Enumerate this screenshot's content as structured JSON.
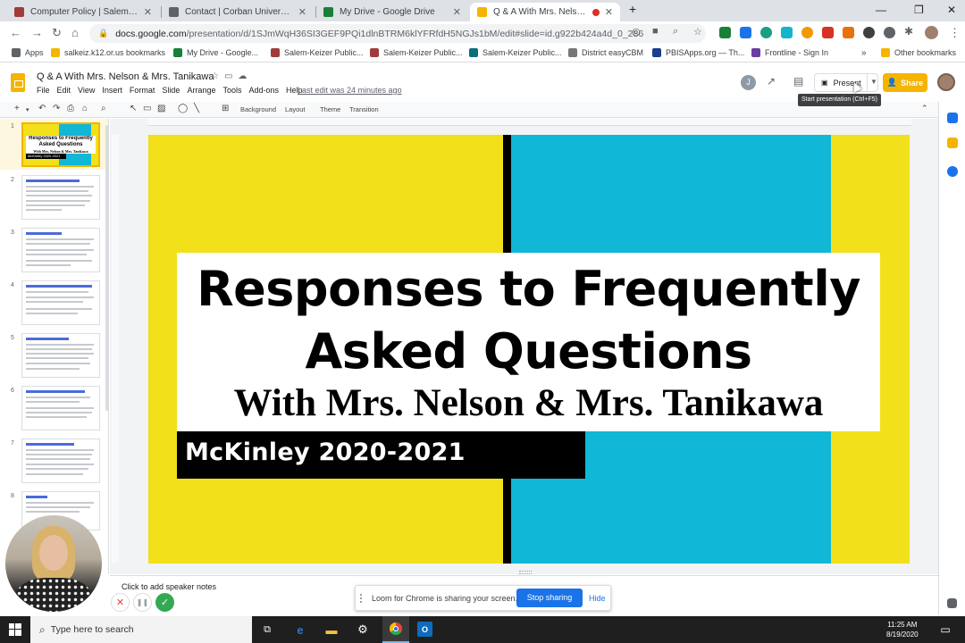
{
  "tabs": [
    {
      "title": "Computer Policy | Salem-Keizer P",
      "favicon": "#a33a3a"
    },
    {
      "title": "Contact | Corban University",
      "favicon": "#5f6368"
    },
    {
      "title": "My Drive - Google Drive",
      "favicon": "#188038"
    },
    {
      "title": "Q & A With Mrs. Nelson & M",
      "favicon": "#f4b400"
    }
  ],
  "address": {
    "host": "docs.google.com",
    "path": "/presentation/d/1SJmWqH36SI3GEF9PQi1dlnBTRM6klYFRfdH5NGJs1bM/edit#slide=id.g922b424a4d_0_286"
  },
  "bookmarks": [
    {
      "label": "Apps",
      "color": "#5f6368"
    },
    {
      "label": "salkeiz.k12.or.us bookmarks",
      "color": "#f4b400"
    },
    {
      "label": "My Drive - Google...",
      "color": "#188038"
    },
    {
      "label": "Salem-Keizer Public...",
      "color": "#a33a3a"
    },
    {
      "label": "Salem-Keizer Public...",
      "color": "#a33a3a"
    },
    {
      "label": "Salem-Keizer Public...",
      "color": "#0b6e7a"
    },
    {
      "label": "District easyCBM",
      "color": "#777777"
    },
    {
      "label": "PBISApps.org — Th...",
      "color": "#1a3d8f"
    },
    {
      "label": "Frontline - Sign In",
      "color": "#6a3da0"
    },
    {
      "label": "Other bookmarks",
      "color": "#f4b400"
    }
  ],
  "doc": {
    "title": "Q & A With Mrs. Nelson & Mrs. Tanikawa",
    "menus": [
      "File",
      "Edit",
      "View",
      "Insert",
      "Format",
      "Slide",
      "Arrange",
      "Tools",
      "Add-ons",
      "Help"
    ],
    "last_edit": "Last edit was 24 minutes ago",
    "avatar_letter": "J",
    "present_label": "Present",
    "share_label": "Share",
    "tooltip": "Start presentation (Ctrl+F5)"
  },
  "toolbar": {
    "background": "Background",
    "layout": "Layout",
    "theme": "Theme",
    "transition": "Transition"
  },
  "thumbnails": {
    "numbers": [
      "1",
      "2",
      "3",
      "4",
      "5",
      "6",
      "7",
      "8"
    ],
    "slide1_title": "Responses to Frequently Asked Questions",
    "slide1_sub": "With Mrs. Nelson & Mrs. Tanikawa",
    "slide1_year": "McKinley 2020-2021"
  },
  "slide": {
    "title": "Responses to Frequently Asked Questions",
    "subtitle": "With Mrs. Nelson & Mrs. Tanikawa",
    "year": "McKinley 2020-2021",
    "colors": {
      "yellow": "#f2e01b",
      "blue": "#10b7d6",
      "black": "#000000"
    }
  },
  "notes_placeholder": "Click to add speaker notes",
  "loom": {
    "message": "Loom for Chrome is sharing your screen.",
    "stop": "Stop sharing",
    "hide": "Hide"
  },
  "taskbar": {
    "search": "Type here to search",
    "time": "11:25 AM",
    "date": "8/19/2020"
  }
}
